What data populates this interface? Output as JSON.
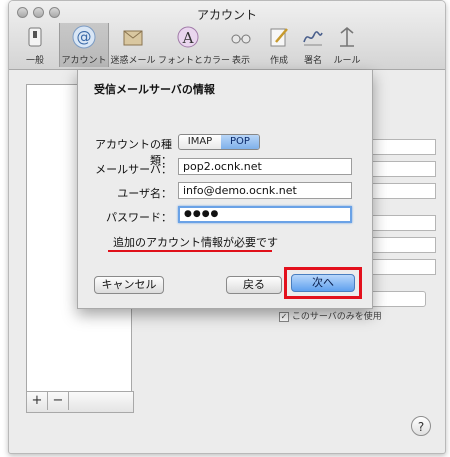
{
  "window": {
    "title": "アカウント"
  },
  "toolbar": {
    "items": [
      {
        "label": "一般",
        "icon": "switch-icon"
      },
      {
        "label": "アカウント",
        "icon": "at-icon"
      },
      {
        "label": "迷惑メール",
        "icon": "junk-mail-icon"
      },
      {
        "label": "フォントとカラー",
        "icon": "font-icon"
      },
      {
        "label": "表示",
        "icon": "glasses-icon"
      },
      {
        "label": "作成",
        "icon": "pencil-icon"
      },
      {
        "label": "署名",
        "icon": "signature-icon"
      },
      {
        "label": "ルール",
        "icon": "rules-icon"
      }
    ]
  },
  "background": {
    "checkbox_label": "このサーバのみを使用"
  },
  "sheet": {
    "title": "受信メールサーバの情報",
    "account_type_label": "アカウントの種類：",
    "account_type_options": [
      "IMAP",
      "POP"
    ],
    "account_type_selected": "POP",
    "mail_server_label": "メールサーバ：",
    "mail_server_value": "pop2.ocnk.net",
    "username_label": "ユーザ名：",
    "username_value": "info@demo.ocnk.net",
    "password_label": "パスワード：",
    "password_value": "●●●●",
    "warning_text": "追加のアカウント情報が必要です",
    "cancel_label": "キャンセル",
    "back_label": "戻る",
    "next_label": "次へ"
  },
  "colors": {
    "highlight_red": "#e3101c",
    "default_button_blue": "#5fa0ee"
  }
}
